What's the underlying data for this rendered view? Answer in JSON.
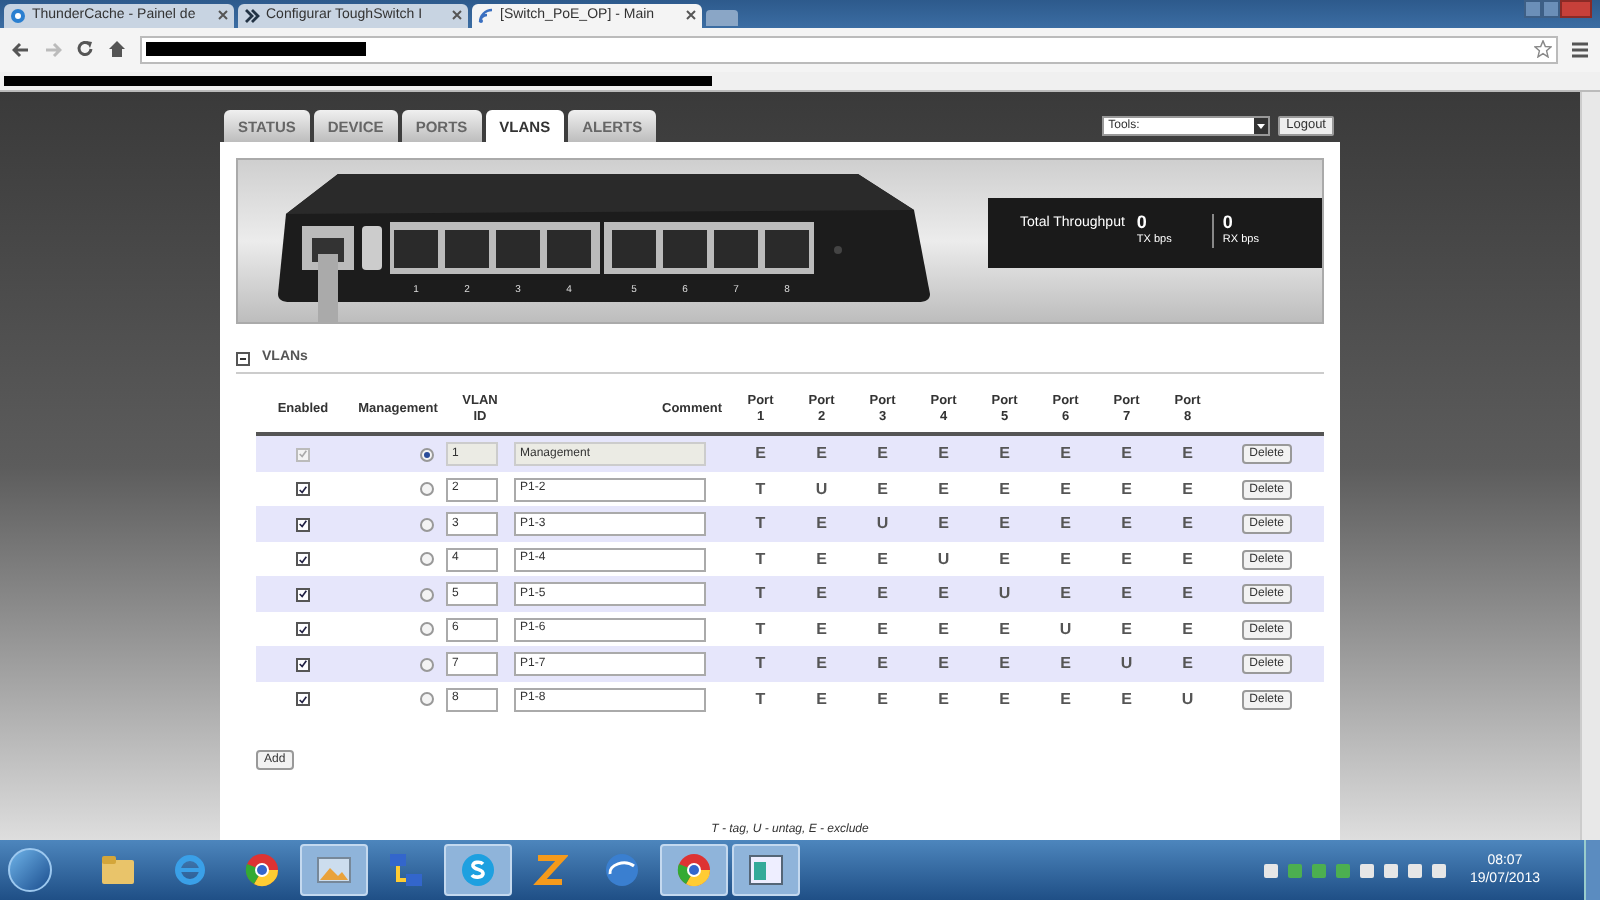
{
  "browser": {
    "tabs": [
      {
        "title": "ThunderCache - Painel de",
        "selected": false,
        "kind": "cache"
      },
      {
        "title": "Configurar ToughSwitch I",
        "selected": false,
        "kind": "ubnt"
      },
      {
        "title": "[Switch_PoE_OP] - Main",
        "selected": true,
        "kind": "feed"
      }
    ]
  },
  "nav": {
    "tabs": [
      {
        "label": "STATUS",
        "selected": false
      },
      {
        "label": "DEVICE",
        "selected": false
      },
      {
        "label": "PORTS",
        "selected": false
      },
      {
        "label": "VLANS",
        "selected": true
      },
      {
        "label": "ALERTS",
        "selected": false
      }
    ],
    "tools": {
      "value": "Tools:"
    },
    "logout": "Logout"
  },
  "device": {
    "port_labels": [
      "1",
      "2",
      "3",
      "4",
      "5",
      "6",
      "7",
      "8"
    ],
    "throughput": {
      "title": "Total Throughput",
      "tx": "0",
      "tx_unit": "TX bps",
      "rx": "0",
      "rx_unit": "RX bps"
    }
  },
  "vlans": {
    "title": "VLANs",
    "expanded": true,
    "columns": [
      "Enabled",
      "Management",
      "VLAN\nID",
      "Comment",
      "Port\n1",
      "Port\n2",
      "Port\n3",
      "Port\n4",
      "Port\n5",
      "Port\n6",
      "Port\n7",
      "Port\n8"
    ],
    "rows": [
      {
        "enabled": true,
        "disabled": true,
        "selected": true,
        "id": "1",
        "comment": "Management",
        "ports": [
          "E",
          "E",
          "E",
          "E",
          "E",
          "E",
          "E",
          "E"
        ],
        "action": "Delete"
      },
      {
        "enabled": true,
        "disabled": false,
        "selected": false,
        "id": "2",
        "comment": "P1-2",
        "ports": [
          "T",
          "U",
          "E",
          "E",
          "E",
          "E",
          "E",
          "E"
        ],
        "action": "Delete"
      },
      {
        "enabled": true,
        "disabled": false,
        "selected": false,
        "id": "3",
        "comment": "P1-3",
        "ports": [
          "T",
          "E",
          "U",
          "E",
          "E",
          "E",
          "E",
          "E"
        ],
        "action": "Delete"
      },
      {
        "enabled": true,
        "disabled": false,
        "selected": false,
        "id": "4",
        "comment": "P1-4",
        "ports": [
          "T",
          "E",
          "E",
          "U",
          "E",
          "E",
          "E",
          "E"
        ],
        "action": "Delete"
      },
      {
        "enabled": true,
        "disabled": false,
        "selected": false,
        "id": "5",
        "comment": "P1-5",
        "ports": [
          "T",
          "E",
          "E",
          "E",
          "U",
          "E",
          "E",
          "E"
        ],
        "action": "Delete"
      },
      {
        "enabled": true,
        "disabled": false,
        "selected": false,
        "id": "6",
        "comment": "P1-6",
        "ports": [
          "T",
          "E",
          "E",
          "E",
          "E",
          "U",
          "E",
          "E"
        ],
        "action": "Delete"
      },
      {
        "enabled": true,
        "disabled": false,
        "selected": false,
        "id": "7",
        "comment": "P1-7",
        "ports": [
          "T",
          "E",
          "E",
          "E",
          "E",
          "E",
          "U",
          "E"
        ],
        "action": "Delete"
      },
      {
        "enabled": true,
        "disabled": false,
        "selected": false,
        "id": "8",
        "comment": "P1-8",
        "ports": [
          "T",
          "E",
          "E",
          "E",
          "E",
          "E",
          "E",
          "U"
        ],
        "action": "Delete"
      }
    ],
    "add": "Add",
    "legend": "T - tag, U - untag, E - exclude"
  },
  "taskbar": {
    "apps": [
      {
        "kind": "folder",
        "running": false
      },
      {
        "kind": "ie",
        "running": false
      },
      {
        "kind": "chrome",
        "running": false
      },
      {
        "kind": "photo",
        "running": true
      },
      {
        "kind": "network",
        "running": false
      },
      {
        "kind": "skype",
        "running": true
      },
      {
        "kind": "zip",
        "running": false
      },
      {
        "kind": "globe",
        "running": false
      },
      {
        "kind": "chrome",
        "running": true
      },
      {
        "kind": "window",
        "running": true
      }
    ],
    "time": "08:07",
    "date": "19/07/2013"
  }
}
